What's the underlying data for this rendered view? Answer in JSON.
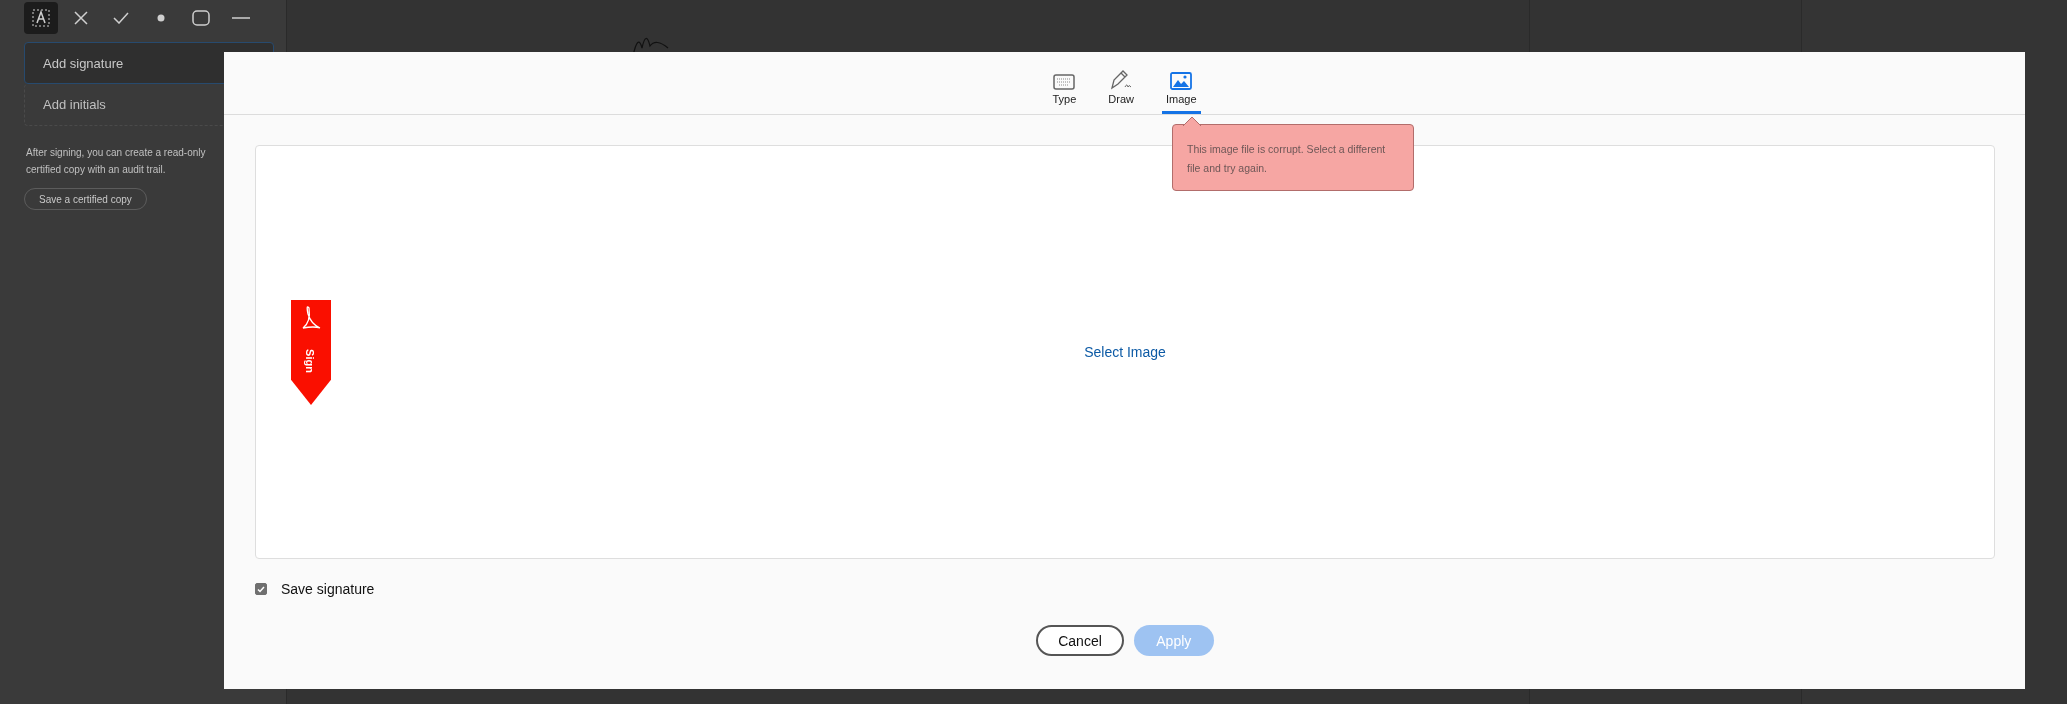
{
  "sidebar": {
    "tools": [
      {
        "kind": "text",
        "selected": true
      },
      {
        "kind": "cross",
        "selected": false
      },
      {
        "kind": "check",
        "selected": false
      },
      {
        "kind": "dot",
        "selected": false
      },
      {
        "kind": "rectangle",
        "selected": false
      },
      {
        "kind": "line",
        "selected": false
      }
    ],
    "actions": [
      {
        "label": "Add signature",
        "selected": true
      },
      {
        "label": "Add initials",
        "selected": false
      }
    ],
    "note": "After signing, you can create a read-only certified copy with an audit trail.",
    "certified_button": "Save a certified copy"
  },
  "dialog": {
    "tabs": [
      {
        "label": "Type",
        "kind": "keyboard",
        "selected": false
      },
      {
        "label": "Draw",
        "kind": "pen",
        "selected": false
      },
      {
        "label": "Image",
        "kind": "image",
        "selected": true
      }
    ],
    "error_tooltip": "This image file is corrupt. Select a different file and try again.",
    "drop_area": {
      "link": "Select Image",
      "flag_label": "Sign"
    },
    "save_signature": {
      "label": "Save signature",
      "checked": true
    },
    "buttons": [
      {
        "label": "Cancel",
        "kind": "secondary",
        "disabled": false
      },
      {
        "label": "Apply",
        "kind": "primary",
        "disabled": true
      }
    ]
  }
}
